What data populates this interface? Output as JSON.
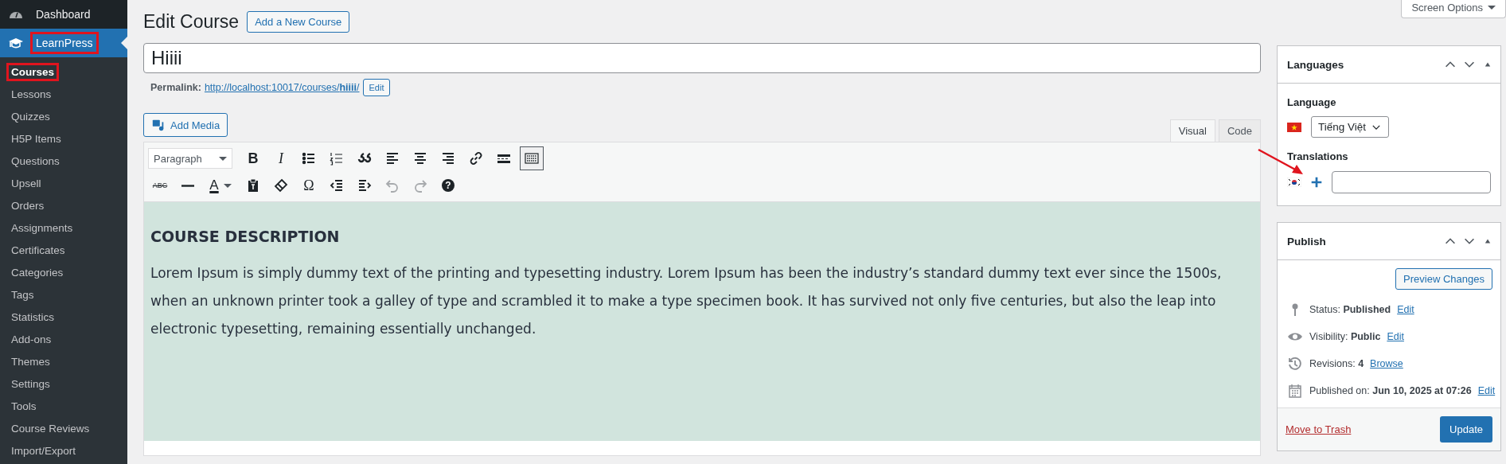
{
  "sidebar": {
    "menu": [
      {
        "label": "Dashboard",
        "kind": "dashboard",
        "selected": false,
        "highlighted": false
      },
      {
        "label": "LearnPress",
        "kind": "learnpress",
        "selected": true,
        "highlighted": true
      }
    ],
    "submenu": [
      {
        "label": "Courses",
        "selected": true,
        "highlighted": true
      },
      {
        "label": "Lessons",
        "selected": false,
        "highlighted": false
      },
      {
        "label": "Quizzes",
        "selected": false,
        "highlighted": false
      },
      {
        "label": "H5P Items",
        "selected": false,
        "highlighted": false
      },
      {
        "label": "Questions",
        "selected": false,
        "highlighted": false
      },
      {
        "label": "Upsell",
        "selected": false,
        "highlighted": false
      },
      {
        "label": "Orders",
        "selected": false,
        "highlighted": false
      },
      {
        "label": "Assignments",
        "selected": false,
        "highlighted": false
      },
      {
        "label": "Certificates",
        "selected": false,
        "highlighted": false
      },
      {
        "label": "Categories",
        "selected": false,
        "highlighted": false
      },
      {
        "label": "Tags",
        "selected": false,
        "highlighted": false
      },
      {
        "label": "Statistics",
        "selected": false,
        "highlighted": false
      },
      {
        "label": "Add-ons",
        "selected": false,
        "highlighted": false
      },
      {
        "label": "Themes",
        "selected": false,
        "highlighted": false
      },
      {
        "label": "Settings",
        "selected": false,
        "highlighted": false
      },
      {
        "label": "Tools",
        "selected": false,
        "highlighted": false
      },
      {
        "label": "Course Reviews",
        "selected": false,
        "highlighted": false
      },
      {
        "label": "Import/Export",
        "selected": false,
        "highlighted": false
      }
    ]
  },
  "page": {
    "title": "Edit Course",
    "add_new": "Add a New Course",
    "screen_options": "Screen Options"
  },
  "post_title": {
    "value": "Hiiii"
  },
  "permalink": {
    "label": "Permalink:",
    "url": "http://localhost:10017/courses/**hiiii**/",
    "edit": "Edit"
  },
  "add_media": "Add Media",
  "editor_tabs": [
    {
      "label": "Visual",
      "selected": true
    },
    {
      "label": "Code",
      "selected": false
    }
  ],
  "toolbar": {
    "rows": [
      [
        {
          "kind": "select",
          "text": "Paragraph"
        },
        {
          "kind": "bold",
          "text": "B",
          "on": false,
          "disabled": false
        },
        {
          "kind": "italic",
          "text": "I",
          "on": false,
          "disabled": false
        },
        {
          "kind": "bullets",
          "on": false,
          "disabled": false
        },
        {
          "kind": "numbers",
          "on": false,
          "disabled": false
        },
        {
          "kind": "quote",
          "on": false,
          "disabled": false
        },
        {
          "kind": "align-left",
          "on": false,
          "disabled": false
        },
        {
          "kind": "align-center",
          "on": false,
          "disabled": false
        },
        {
          "kind": "align-right",
          "on": false,
          "disabled": false
        },
        {
          "kind": "link",
          "on": false,
          "disabled": false
        },
        {
          "kind": "more",
          "on": false,
          "disabled": false
        },
        {
          "kind": "toggle",
          "on": true,
          "disabled": false
        }
      ],
      [
        {
          "kind": "strike",
          "text": "ABC",
          "on": false,
          "disabled": false
        },
        {
          "kind": "hr",
          "on": false,
          "disabled": false
        },
        {
          "kind": "color",
          "text": "A",
          "on": false,
          "disabled": false
        },
        {
          "kind": "paste",
          "on": false,
          "disabled": false
        },
        {
          "kind": "eraser",
          "on": false,
          "disabled": false
        },
        {
          "kind": "special",
          "text": "Ω",
          "on": false,
          "disabled": false
        },
        {
          "kind": "outdent",
          "on": false,
          "disabled": false
        },
        {
          "kind": "indent",
          "on": false,
          "disabled": false
        },
        {
          "kind": "undo",
          "on": false,
          "disabled": true
        },
        {
          "kind": "redo",
          "on": false,
          "disabled": true
        },
        {
          "kind": "help",
          "text": "?",
          "on": false,
          "disabled": false
        }
      ]
    ]
  },
  "content": {
    "heading": "COURSE DESCRIPTION",
    "paragraph": "Lorem Ipsum is simply dummy text of the printing and typesetting industry. Lorem Ipsum has been the industry’s standard dummy text ever since the 1500s, when an unknown printer took a galley of type and scrambled it to make a type specimen book. It has survived not only five centuries, but also the leap into electronic typesetting, remaining essentially unchanged."
  },
  "languages_box": {
    "title": "Languages",
    "language_label": "Language",
    "language_value": "Tiếng Việt",
    "translations_label": "Translations",
    "translation": {
      "annotated": true
    }
  },
  "publish_box": {
    "title": "Publish",
    "preview": "Preview Changes",
    "rows": [
      {
        "kind": "status",
        "text": "Status: **Published**",
        "link": "Edit"
      },
      {
        "kind": "visibility",
        "text": "Visibility: **Public**",
        "link": "Edit"
      },
      {
        "kind": "revisions",
        "text": "Revisions: **4**",
        "link": "Browse"
      },
      {
        "kind": "date",
        "text": "Published on: **Jun 10, 2025 at 07:26**",
        "link": "Edit"
      }
    ],
    "trash": "Move to Trash",
    "update": "Update"
  }
}
